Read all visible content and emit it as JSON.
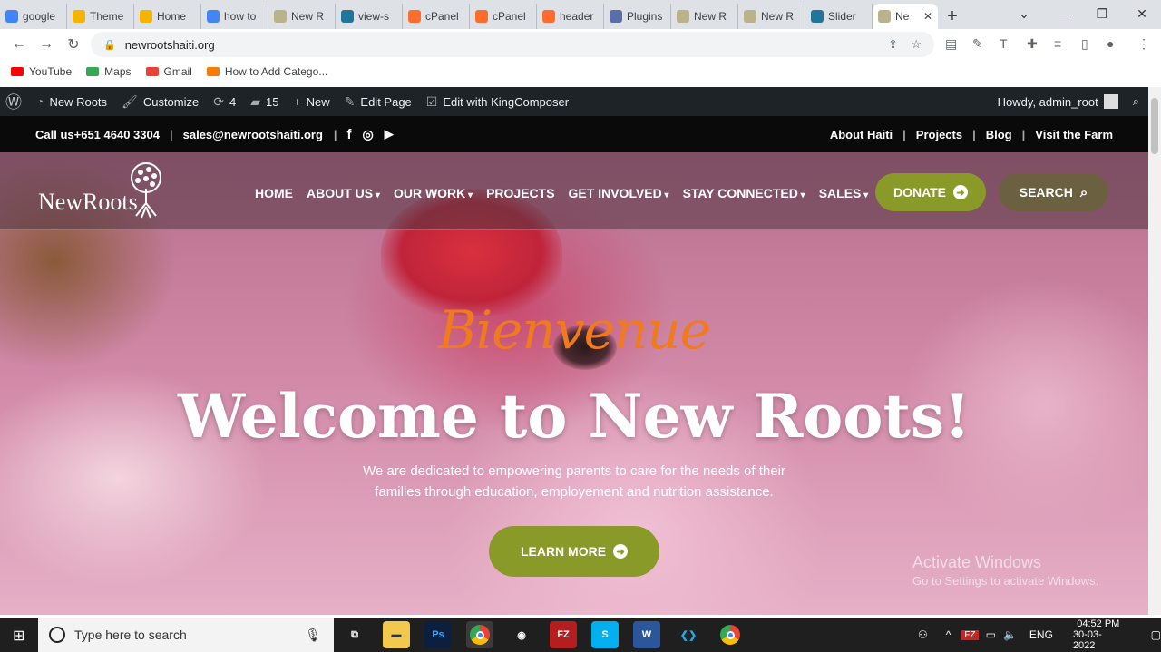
{
  "browser": {
    "tabs": [
      {
        "label": "google",
        "icon": "google-icon",
        "color": "#4285f4"
      },
      {
        "label": "Theme",
        "icon": "cpanel-smile-icon",
        "color": "#f4b400"
      },
      {
        "label": "Home",
        "icon": "cpanel-smile-icon",
        "color": "#f4b400"
      },
      {
        "label": "how to",
        "icon": "google-icon",
        "color": "#4285f4"
      },
      {
        "label": "New R",
        "icon": "tree-icon",
        "color": "#b9b28a"
      },
      {
        "label": "view-s",
        "icon": "wordpress-icon",
        "color": "#21759b"
      },
      {
        "label": "cPanel",
        "icon": "cpanel-icon",
        "color": "#ff6c2c"
      },
      {
        "label": "cPanel",
        "icon": "cpanel-icon",
        "color": "#ff6c2c"
      },
      {
        "label": "header",
        "icon": "cpanel-icon",
        "color": "#ff6c2c"
      },
      {
        "label": "Plugins",
        "icon": "plugin-icon",
        "color": "#5a6fa8"
      },
      {
        "label": "New R",
        "icon": "tree-icon",
        "color": "#b9b28a"
      },
      {
        "label": "New R",
        "icon": "tree-icon",
        "color": "#b9b28a"
      },
      {
        "label": "Slider",
        "icon": "wordpress-icon",
        "color": "#21759b"
      }
    ],
    "active_tab": {
      "label": "Ne",
      "close": "✕"
    },
    "new_tab": "+",
    "url": "newrootshaiti.org",
    "bookmarks": [
      {
        "label": "YouTube",
        "color": "#ff0000"
      },
      {
        "label": "Maps",
        "color": "#34a853"
      },
      {
        "label": "Gmail",
        "color": "#ea4335"
      },
      {
        "label": "How to Add Catego...",
        "color": "#f57c00"
      }
    ]
  },
  "wp_admin_bar": {
    "site_name": "New Roots",
    "customize": "Customize",
    "updates_count": "4",
    "comments_count": "15",
    "new": "New",
    "edit_page": "Edit Page",
    "edit_kingcomposer": "Edit with KingComposer",
    "howdy": "Howdy, admin_root"
  },
  "top_bar": {
    "phone": "Call us+651 4640 3304",
    "email": "sales@newrootshaiti.org",
    "links": [
      "About Haiti",
      "Projects",
      "Blog",
      "Visit the Farm"
    ]
  },
  "site_header": {
    "logo_text": "NewRoots",
    "menu": [
      "HOME",
      "ABOUT US",
      "OUR WORK",
      "PROJECTS",
      "GET INVOLVED",
      "STAY CONNECTED",
      "SALES"
    ],
    "menu_dropdown": [
      false,
      true,
      true,
      false,
      true,
      true,
      true
    ],
    "donate_label": "DONATE",
    "search_label": "SEARCH"
  },
  "hero": {
    "script_title": "Bienvenue",
    "headline": "Welcome to New Roots!",
    "subtext_line1": "We are dedicated to empowering parents to care for the needs of their",
    "subtext_line2": "families through education, employement and nutrition assistance.",
    "cta_label": "LEARN MORE",
    "accent_color": "#8a9a28",
    "script_color": "#f07a1e"
  },
  "os_watermark": {
    "line1": "Activate Windows",
    "line2": "Go to Settings to activate Windows."
  },
  "taskbar": {
    "search_placeholder": "Type here to search",
    "apps": [
      {
        "name": "task-view",
        "label": ""
      },
      {
        "name": "file-explorer",
        "label": ""
      },
      {
        "name": "photoshop",
        "label": "Ps"
      },
      {
        "name": "chrome",
        "label": ""
      },
      {
        "name": "record",
        "label": ""
      },
      {
        "name": "filezilla",
        "label": "FZ"
      },
      {
        "name": "skype",
        "label": "S"
      },
      {
        "name": "word",
        "label": "W"
      },
      {
        "name": "vscode",
        "label": ""
      },
      {
        "name": "chrome-2",
        "label": ""
      }
    ],
    "language": "ENG",
    "time": "04:52 PM",
    "date": "30-03-2022"
  }
}
